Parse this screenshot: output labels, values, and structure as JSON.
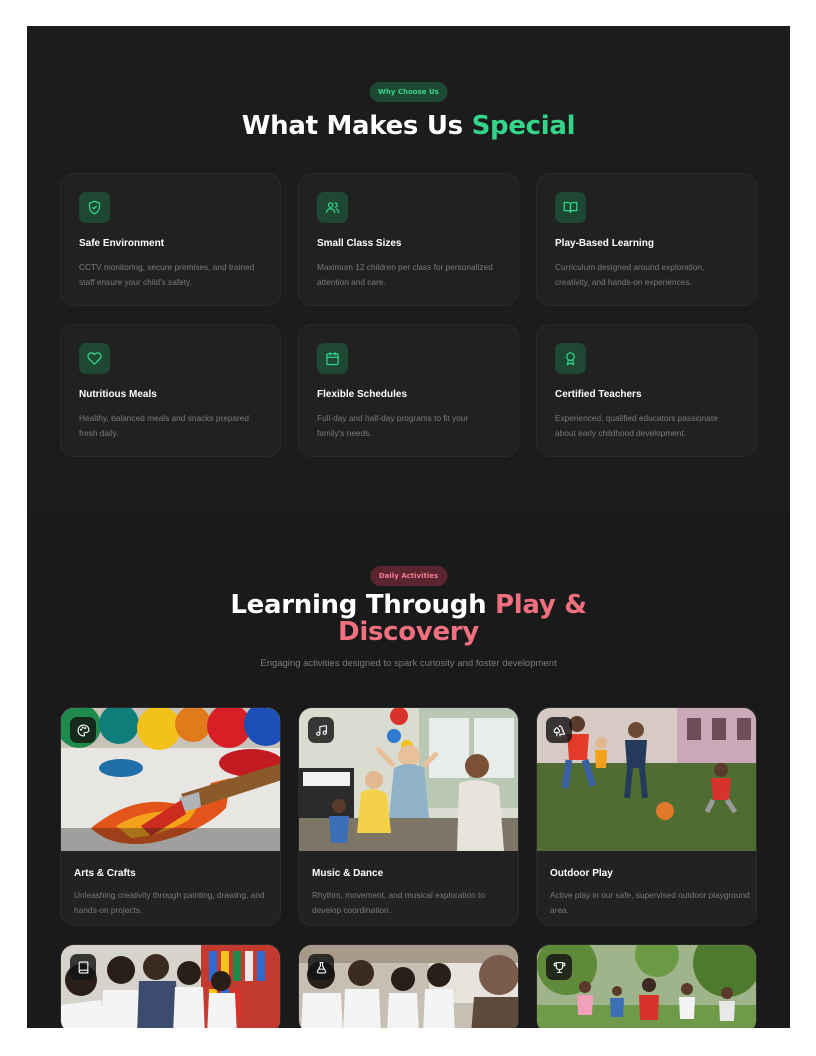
{
  "why": {
    "badge": "Why Choose Us",
    "title_main": "What Makes Us ",
    "title_accent": "Special",
    "features": [
      {
        "icon": "shield-check-icon",
        "title": "Safe Environment",
        "desc": "CCTV monitoring, secure premises, and trained staff ensure your child's safety."
      },
      {
        "icon": "users-icon",
        "title": "Small Class Sizes",
        "desc": "Maximum 12 children per class for personalized attention and care."
      },
      {
        "icon": "book-open-icon",
        "title": "Play-Based Learning",
        "desc": "Curriculum designed around exploration, creativity, and hands-on experiences."
      },
      {
        "icon": "heart-icon",
        "title": "Nutritious Meals",
        "desc": "Healthy, balanced meals and snacks prepared fresh daily."
      },
      {
        "icon": "calendar-icon",
        "title": "Flexible Schedules",
        "desc": "Full-day and half-day programs to fit your family's needs."
      },
      {
        "icon": "award-icon",
        "title": "Certified Teachers",
        "desc": "Experienced, qualified educators passionate about early childhood development."
      }
    ]
  },
  "activities": {
    "badge": "Daily Activities",
    "title_main": "Learning Through ",
    "title_accent_1": "Play &",
    "title_accent_2": "Discovery",
    "subtitle": "Engaging activities designed to spark curiosity and foster development",
    "cards": [
      {
        "icon": "palette-icon",
        "title": "Arts & Crafts",
        "desc": "Unleashing creativity through painting, drawing, and hands-on projects."
      },
      {
        "icon": "music-icon",
        "title": "Music & Dance",
        "desc": "Rhythm, movement, and musical exploration to develop coordination."
      },
      {
        "icon": "trees-icon",
        "title": "Outdoor Play",
        "desc": "Active play in our safe, supervised outdoor playground area."
      },
      {
        "icon": "book-icon",
        "title": "",
        "desc": ""
      },
      {
        "icon": "flask-icon",
        "title": "",
        "desc": ""
      },
      {
        "icon": "trophy-icon",
        "title": "",
        "desc": ""
      }
    ]
  },
  "colors": {
    "background": "#1b1b1b",
    "accent_green": "#34d58a",
    "accent_pink": "#f0707f"
  }
}
